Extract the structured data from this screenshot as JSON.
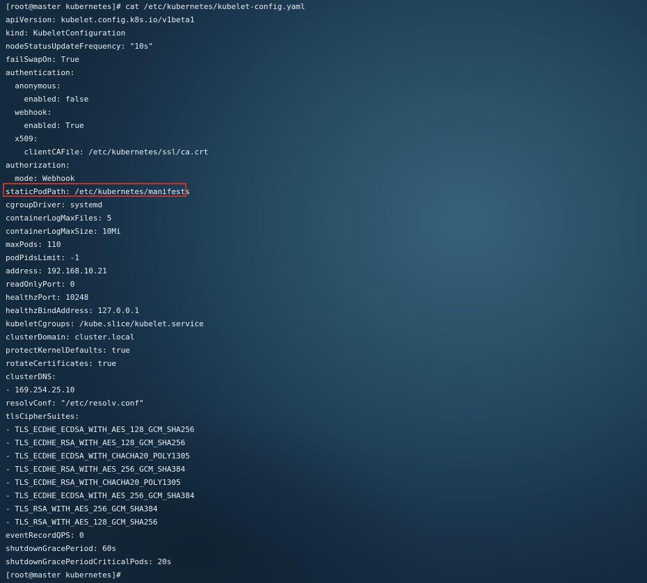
{
  "terminal": {
    "prompt_command": "[root@master kubernetes]# cat /etc/kubernetes/kubelet-config.yaml",
    "lines": [
      "apiVersion: kubelet.config.k8s.io/v1beta1",
      "kind: KubeletConfiguration",
      "nodeStatusUpdateFrequency: \"10s\"",
      "failSwapOn: True",
      "authentication:",
      "  anonymous:",
      "    enabled: false",
      "  webhook:",
      "    enabled: True",
      "  x509:",
      "    clientCAFile: /etc/kubernetes/ssl/ca.crt",
      "authorization:",
      "  mode: Webhook",
      "staticPodPath: /etc/kubernetes/manifests",
      "cgroupDriver: systemd",
      "containerLogMaxFiles: 5",
      "containerLogMaxSize: 10Mi",
      "maxPods: 110",
      "podPidsLimit: -1",
      "address: 192.168.10.21",
      "readOnlyPort: 0",
      "healthzPort: 10248",
      "healthzBindAddress: 127.0.0.1",
      "kubeletCgroups: /kube.slice/kubelet.service",
      "clusterDomain: cluster.local",
      "protectKernelDefaults: true",
      "rotateCertificates: true",
      "clusterDNS:",
      "- 169.254.25.10",
      "resolvConf: \"/etc/resolv.conf\"",
      "tlsCipherSuites:",
      "- TLS_ECDHE_ECDSA_WITH_AES_128_GCM_SHA256",
      "- TLS_ECDHE_RSA_WITH_AES_128_GCM_SHA256",
      "- TLS_ECDHE_ECDSA_WITH_CHACHA20_POLY1305",
      "- TLS_ECDHE_RSA_WITH_AES_256_GCM_SHA384",
      "- TLS_ECDHE_RSA_WITH_CHACHA20_POLY1305",
      "- TLS_ECDHE_ECDSA_WITH_AES_256_GCM_SHA384",
      "- TLS_RSA_WITH_AES_256_GCM_SHA384",
      "- TLS_RSA_WITH_AES_128_GCM_SHA256",
      "eventRecordQPS: 0",
      "shutdownGracePeriod: 60s",
      "shutdownGracePeriodCriticalPods: 20s"
    ],
    "final_prompt": "[root@master kubernetes]# ",
    "highlighted_line": "staticPodPath: /etc/kubernetes/manifests",
    "colors": {
      "text": "#e6edf2",
      "highlight_border": "#c9302c",
      "background": "#1b3547"
    }
  }
}
